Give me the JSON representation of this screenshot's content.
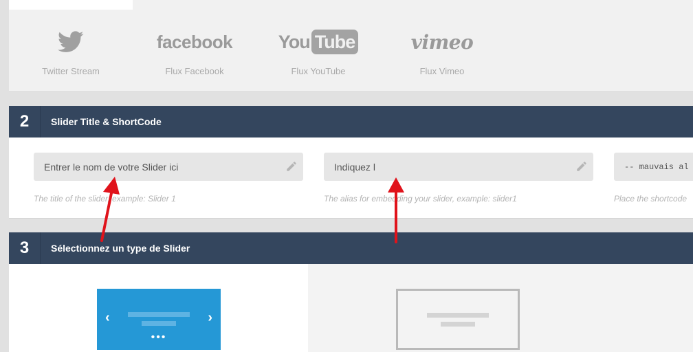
{
  "sources": [
    {
      "id": "twitter",
      "label": "Twitter Stream",
      "icon": "twitter-bird-icon"
    },
    {
      "id": "facebook",
      "label": "Flux Facebook",
      "logo_text": "facebook"
    },
    {
      "id": "youtube",
      "label": "Flux YouTube",
      "logo_text_a": "You",
      "logo_text_b": "Tube"
    },
    {
      "id": "vimeo",
      "label": "Flux Vimeo",
      "logo_text": "vimeo"
    }
  ],
  "section2": {
    "number": "2",
    "title": "Slider Title & ShortCode",
    "title_field": {
      "value": "Entrer le nom de votre Slider ici",
      "hint": "The title of the slider, example: Slider 1"
    },
    "alias_field": {
      "value": "Indiquez l",
      "hint": "The alias for embedding your slider, example: slider1"
    },
    "shortcode_field": {
      "value": "-- mauvais al",
      "hint": "Place the shortcode"
    }
  },
  "section3": {
    "number": "3",
    "title": "Sélectionnez un type de Slider",
    "types": [
      {
        "id": "standard",
        "selected": true,
        "icons": {
          "left": "‹",
          "right": "›",
          "dots": "•••"
        }
      },
      {
        "id": "other",
        "selected": false
      }
    ]
  },
  "colors": {
    "header_bar": "#34465e",
    "selected_thumb": "#2598d6",
    "annotation_arrow": "#e0131b"
  }
}
